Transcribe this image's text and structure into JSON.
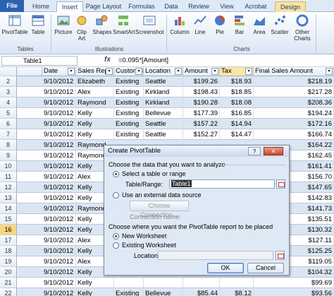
{
  "tabs": [
    "File",
    "Home",
    "Insert",
    "Page Layout",
    "Formulas",
    "Data",
    "Review",
    "View",
    "Acrobat",
    "Design"
  ],
  "ribbon": {
    "buttons": [
      "PivotTable",
      "Table",
      "Picture",
      "Clip Art",
      "Shapes",
      "SmartArt",
      "Screenshot",
      "Column",
      "Line",
      "Pie",
      "Bar",
      "Area",
      "Scatter",
      "Other Charts"
    ],
    "groups": [
      "Tables",
      "Illustrations",
      "Charts"
    ]
  },
  "formula_bar": {
    "name_box": "Table1",
    "fx": "fx",
    "formula": "=0.095*[Amount]"
  },
  "columns": [
    "Date",
    "Sales Rep",
    "Customer",
    "Location",
    "Amount",
    "Tax",
    "Final Sales Amount"
  ],
  "row_numbers": [
    "1",
    "2",
    "3",
    "4",
    "5",
    "6",
    "7",
    "8",
    "9",
    "10",
    "11",
    "12",
    "13",
    "14",
    "15",
    "16",
    "17",
    "18",
    "19",
    "20",
    "21",
    "22"
  ],
  "rows": [
    [
      "9/10/2012",
      "Elizabeth",
      "Existing",
      "Seattle",
      "$199.26",
      "$18.93",
      "$218.19"
    ],
    [
      "9/10/2012",
      "Alex",
      "Existing",
      "Kirkland",
      "$198.43",
      "$18.85",
      "$217.28"
    ],
    [
      "9/10/2012",
      "Raymond",
      "Existing",
      "Kirkland",
      "$190.28",
      "$18.08",
      "$208.36"
    ],
    [
      "9/10/2012",
      "Kelly",
      "Existing",
      "Bellevue",
      "$177.39",
      "$16.85",
      "$194.24"
    ],
    [
      "9/10/2012",
      "Kelly",
      "Existing",
      "Seattle",
      "$157.22",
      "$14.94",
      "$172.16"
    ],
    [
      "9/10/2012",
      "Kelly",
      "Existing",
      "Seattle",
      "$152.27",
      "$14.47",
      "$166.74"
    ],
    [
      "9/10/2012",
      "Raymond",
      "",
      "",
      "",
      "",
      "$164.22"
    ],
    [
      "9/10/2012",
      "Raymond",
      "",
      "",
      "",
      "",
      "$162.45"
    ],
    [
      "9/10/2012",
      "Kelly",
      "",
      "",
      "",
      "",
      "$161.41"
    ],
    [
      "9/10/2012",
      "Alex",
      "",
      "",
      "",
      "",
      "$156.70"
    ],
    [
      "9/10/2012",
      "Kelly",
      "",
      "",
      "",
      "",
      "$147.65"
    ],
    [
      "9/10/2012",
      "Kelly",
      "",
      "",
      "",
      "",
      "$142.83"
    ],
    [
      "9/10/2012",
      "Raymond",
      "",
      "",
      "",
      "",
      "$141.73"
    ],
    [
      "9/10/2012",
      "Kelly",
      "",
      "",
      "",
      "",
      "$135.51"
    ],
    [
      "9/10/2012",
      "Kelly",
      "",
      "",
      "",
      "",
      "$130.32"
    ],
    [
      "9/10/2012",
      "Alex",
      "",
      "",
      "",
      "",
      "$127.11"
    ],
    [
      "9/10/2012",
      "Kelly",
      "",
      "",
      "",
      "",
      "$125.25"
    ],
    [
      "9/10/2012",
      "Alex",
      "",
      "",
      "",
      "",
      "$119.05"
    ],
    [
      "9/10/2012",
      "Kelly",
      "",
      "",
      "",
      "",
      "$104.32"
    ],
    [
      "9/10/2012",
      "Kelly",
      "",
      "",
      "",
      "",
      "$99.69"
    ],
    [
      "9/10/2012",
      "Kelly",
      "Existing",
      "Bellevue",
      "$85.44",
      "$8.12",
      "$93.56"
    ]
  ],
  "dialog": {
    "title": "Create PivotTable",
    "help": "?",
    "close": "✕",
    "section1": "Choose the data that you want to analyze",
    "opt_select": "Select a table or range",
    "table_range_label": "Table/Range:",
    "table_range_value": "Table1",
    "opt_external": "Use an external data source",
    "choose_connection": "Choose Connection...",
    "connection_name": "Connection name:",
    "section2": "Choose where you want the PivotTable report to be placed",
    "opt_new": "New Worksheet",
    "opt_existing": "Existing Worksheet",
    "location_label": "Location:",
    "ok": "OK",
    "cancel": "Cancel"
  }
}
